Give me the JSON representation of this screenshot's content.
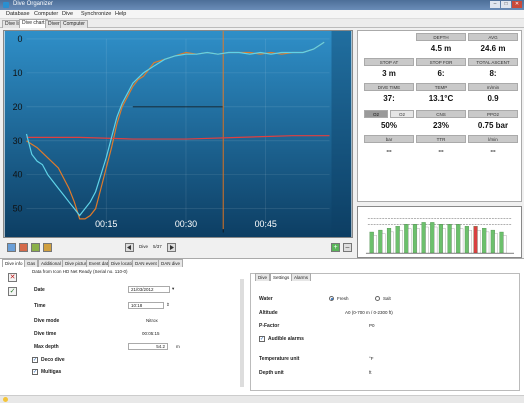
{
  "window": {
    "title": "Dive Organizer",
    "buttons": [
      "–",
      "□",
      "✕"
    ]
  },
  "menu": [
    "Database",
    "Computer",
    "Dive",
    "Synchronize",
    "Help"
  ],
  "tabs": [
    "Dive list",
    "Dive chart",
    "Diver",
    "Computer"
  ],
  "active_tab": "Dive chart",
  "chart_data": {
    "type": "line",
    "x_ticks": [
      "00:15",
      "00:30",
      "00:45"
    ],
    "y_ticks_left": [
      "0",
      "10",
      "20",
      "30",
      "40",
      "50"
    ],
    "x_label": "",
    "y_label": "",
    "x_range_minutes": [
      0,
      57
    ],
    "y_range_depth_m": [
      0,
      56
    ],
    "series": [
      {
        "name": "",
        "color": "#e07a2a",
        "points": [
          [
            0,
            30
          ],
          [
            2,
            32
          ],
          [
            4,
            35
          ],
          [
            6,
            38
          ],
          [
            8,
            44
          ],
          [
            9,
            48
          ],
          [
            10,
            53
          ],
          [
            11,
            53
          ],
          [
            12,
            52
          ],
          [
            13,
            50
          ],
          [
            14,
            44
          ],
          [
            15,
            38
          ],
          [
            16,
            32
          ],
          [
            17,
            25
          ],
          [
            18,
            20
          ],
          [
            19,
            17
          ],
          [
            20,
            14
          ],
          [
            21,
            12
          ],
          [
            22,
            11
          ],
          [
            23,
            9
          ],
          [
            24,
            7
          ],
          [
            26,
            6
          ],
          [
            28,
            5
          ],
          [
            30,
            4
          ],
          [
            32,
            4.5
          ],
          [
            34,
            4
          ],
          [
            36,
            4.5
          ],
          [
            38,
            4
          ],
          [
            40,
            4
          ],
          [
            42,
            4
          ],
          [
            44,
            4.5
          ],
          [
            46,
            4
          ],
          [
            48,
            4.5
          ],
          [
            50,
            4
          ],
          [
            52,
            4
          ],
          [
            54,
            3
          ],
          [
            55,
            2
          ],
          [
            56,
            1
          ]
        ]
      },
      {
        "name": "",
        "color": "#e04040",
        "points": [
          [
            0,
            29
          ],
          [
            10,
            29
          ],
          [
            20,
            29.5
          ],
          [
            30,
            29.5
          ],
          [
            40,
            29
          ],
          [
            50,
            28.5
          ],
          [
            57,
            28.5
          ]
        ]
      },
      {
        "name": "",
        "color": "#5fd3e8",
        "points": [
          [
            0,
            28
          ],
          [
            1,
            34
          ],
          [
            2,
            36
          ],
          [
            3,
            37
          ],
          [
            4,
            40
          ],
          [
            5,
            42
          ],
          [
            6,
            44
          ],
          [
            7,
            46
          ],
          [
            8,
            48
          ],
          [
            9,
            50
          ],
          [
            10,
            52
          ],
          [
            11,
            50
          ],
          [
            12,
            48
          ],
          [
            13,
            45
          ],
          [
            14,
            40
          ],
          [
            15,
            35
          ],
          [
            16,
            29
          ],
          [
            17,
            23
          ],
          [
            18,
            19
          ],
          [
            19,
            16
          ],
          [
            20,
            13
          ],
          [
            22,
            10
          ],
          [
            24,
            8
          ],
          [
            26,
            6
          ],
          [
            28,
            5
          ],
          [
            30,
            4.5
          ],
          [
            32,
            4.5
          ],
          [
            34,
            4
          ],
          [
            36,
            4.5
          ],
          [
            38,
            4
          ],
          [
            40,
            4
          ],
          [
            42,
            4.5
          ],
          [
            44,
            4
          ],
          [
            46,
            4.5
          ],
          [
            48,
            4
          ],
          [
            50,
            4
          ],
          [
            52,
            4
          ],
          [
            54,
            3
          ],
          [
            56,
            1
          ]
        ]
      }
    ],
    "markers": {
      "vertical_orange_minute": 37,
      "step_box": [
        [
          20,
          20
        ],
        [
          37,
          20
        ],
        [
          37,
          57
        ]
      ]
    }
  },
  "stats": [
    {
      "label": "DEPTH",
      "value": "4.5 m"
    },
    {
      "label": "AVG",
      "value": "24.6 m"
    },
    {
      "label": "STOP AT",
      "value": "3 m"
    },
    {
      "label": "STOP FOR",
      "value": "6:"
    },
    {
      "label": "TOTAL ASCENT",
      "value": "8:"
    },
    {
      "label": "DIVE TIME",
      "value": "37:"
    },
    {
      "label": "TEMP",
      "value": "13.1°C"
    },
    {
      "label": "m/min",
      "value": "0.9"
    },
    {
      "label": "O2",
      "value": "50%"
    },
    {
      "label": "CNS",
      "value": "23%"
    },
    {
      "label": "PPO2",
      "value": "0.75 bar"
    },
    {
      "label": "bar",
      "value": "--"
    },
    {
      "label": "TTR",
      "value": "--"
    },
    {
      "label": "l/min",
      "value": "--"
    }
  ],
  "stats_o2_tags": [
    "O2",
    "O2"
  ],
  "controls": {
    "dive_label": "Dive",
    "dive_counter": "5/37"
  },
  "bottom_tabs": [
    "Dive info",
    "Gas",
    "Additional info",
    "Dive picture",
    "Event data",
    "Dive location",
    "DAN event",
    "DAN dive"
  ],
  "dive_info": {
    "header": "Data from Icon HD Net Ready (Serial no. 110-0)",
    "date_label": "Date",
    "date_value": "21/03/2012",
    "time_label": "Time",
    "time_value": "10:18",
    "mode_label": "Dive mode",
    "mode_value": "Nitrox",
    "divetime_label": "Dive time",
    "divetime_value": "00:05:15",
    "maxdepth_label": "Max depth",
    "maxdepth_value": "54.2",
    "maxdepth_unit": "m",
    "deco_label": "Deco dive",
    "multigas_label": "Multigas"
  },
  "settings_tabs": [
    "Dive",
    "Settings",
    "Alarms"
  ],
  "settings": {
    "water_label": "Water",
    "fresh": "Fresh",
    "salt": "Salt",
    "altitude_label": "Altitude",
    "altitude_value": "A0 (0-700 m / 0-2300 ft)",
    "pfactor_label": "P-Factor",
    "pfactor_value": "P0",
    "audible_label": "Audible alarms",
    "temp_label": "Temperature unit",
    "temp_value": "°F",
    "depth_label": "Depth unit",
    "depth_value": "ft"
  }
}
